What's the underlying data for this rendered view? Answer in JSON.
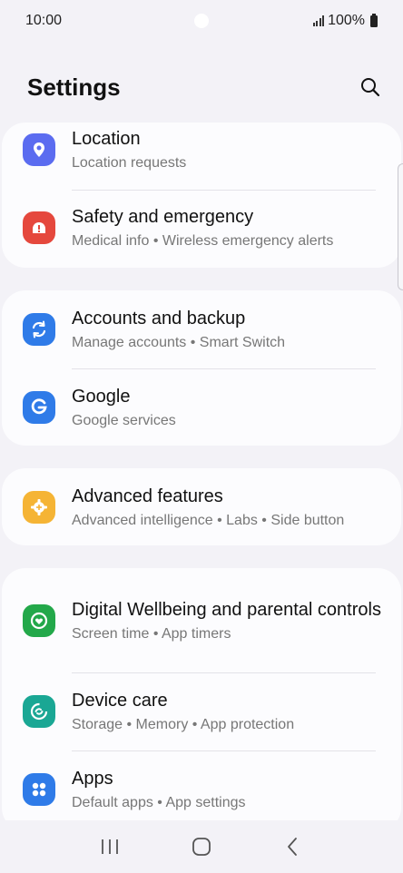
{
  "status": {
    "time": "10:00",
    "battery": "100%"
  },
  "header": {
    "title": "Settings"
  },
  "groups": [
    {
      "items": [
        {
          "title": "Location",
          "subtitle": "Location requests",
          "icon": "location-pin-icon",
          "color": "#5b6cf0"
        },
        {
          "title": "Safety and emergency",
          "subtitle": "Medical info  •  Wireless emergency alerts",
          "icon": "emergency-alert-icon",
          "color": "#e5483d"
        }
      ]
    },
    {
      "items": [
        {
          "title": "Accounts and backup",
          "subtitle": "Manage accounts  •  Smart Switch",
          "icon": "sync-icon",
          "color": "#2f7be8"
        },
        {
          "title": "Google",
          "subtitle": "Google services",
          "icon": "google-g-icon",
          "color": "#2f7be8"
        }
      ]
    },
    {
      "items": [
        {
          "title": "Advanced features",
          "subtitle": "Advanced intelligence  •  Labs  •  Side button",
          "icon": "gear-plus-icon",
          "color": "#f5b435"
        }
      ]
    },
    {
      "items": [
        {
          "title": "Digital Wellbeing and parental controls",
          "subtitle": "Screen time  •  App timers",
          "icon": "heart-circle-icon",
          "color": "#23a84a"
        },
        {
          "title": "Device care",
          "subtitle": "Storage  •  Memory  •  App protection",
          "icon": "device-care-icon",
          "color": "#1aa794"
        },
        {
          "title": "Apps",
          "subtitle": "Default apps  •  App settings",
          "icon": "apps-grid-icon",
          "color": "#2f7be8"
        }
      ]
    }
  ]
}
